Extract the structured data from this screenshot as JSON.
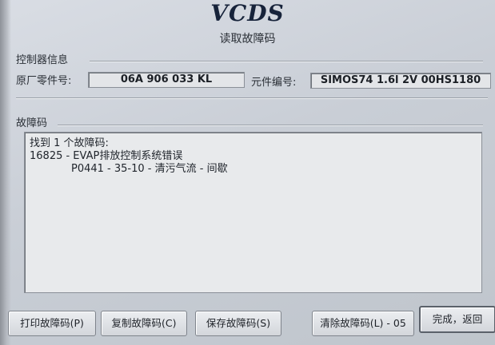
{
  "header": {
    "app_title": "VCDS",
    "screen_title": "读取故障码"
  },
  "controller_info": {
    "group_label": "控制器信息",
    "part_number_label": "原厂零件号:",
    "part_number_value": "06A 906 033 KL",
    "component_label": "元件编号:",
    "component_value": "SIMOS74 1.6l 2V 00HS1180"
  },
  "faults": {
    "group_label": "故障码",
    "lines": [
      "找到 1 个故障码:",
      "16825 - EVAP排放控制系统错误",
      "P0441 - 35-10 - 清污气流 - 间歇"
    ]
  },
  "buttons": {
    "print": "打印故障码(P)",
    "copy": "复制故障码(C)",
    "save": "保存故障码(S)",
    "clear": "清除故障码(L) - 05",
    "done": "完成，返回"
  }
}
